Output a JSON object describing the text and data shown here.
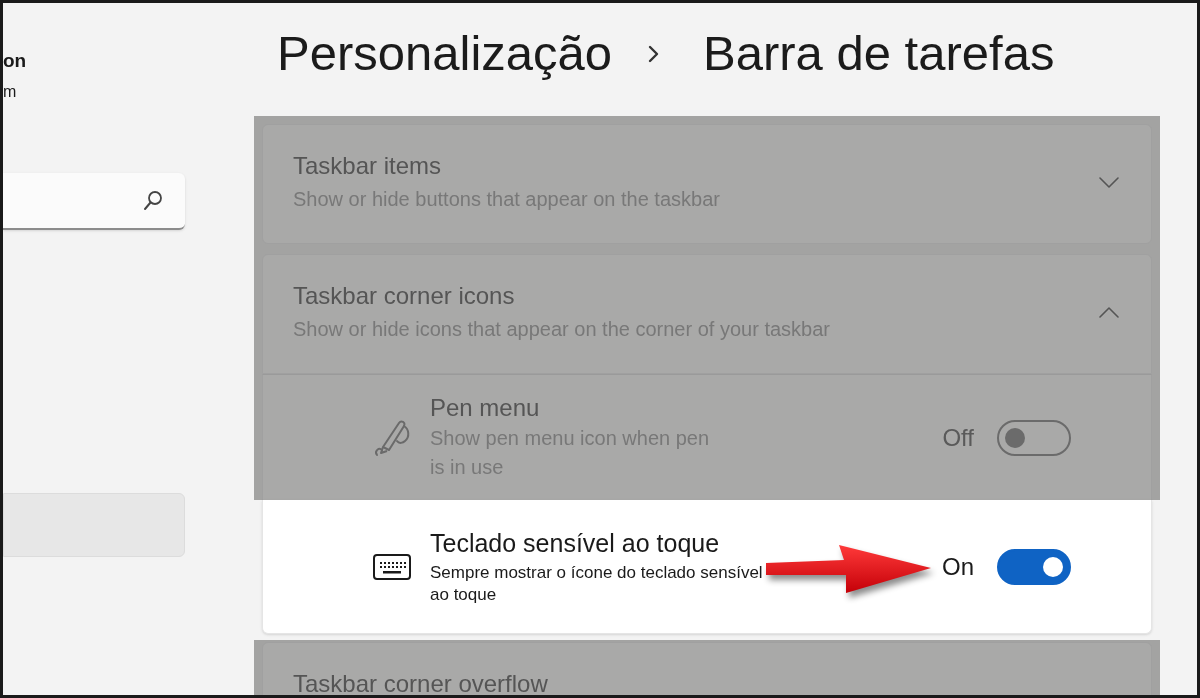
{
  "sidebar": {
    "profile_name": "on",
    "profile_subtitle": "m",
    "nav_items": [
      {
        "selected": true
      }
    ]
  },
  "breadcrumb": [
    {
      "label": "Personalização"
    },
    {
      "label": "Barra de tarefas"
    }
  ],
  "settings": [
    {
      "kind": "group",
      "title": "Taskbar items",
      "subtitle": "Show or hide buttons that appear on the taskbar",
      "expanded": false,
      "highlighted": false
    },
    {
      "kind": "group",
      "title": "Taskbar corner icons",
      "subtitle": "Show or hide icons that appear on the corner of your taskbar",
      "expanded": true,
      "highlighted": false,
      "children": [
        {
          "kind": "toggle",
          "title": "Pen menu",
          "subtitle": "Show pen menu icon when pen is in use",
          "state_label": "Off",
          "on": false,
          "highlighted": false
        },
        {
          "kind": "toggle",
          "title": "Teclado sensível ao toque",
          "subtitle": "Sempre mostrar o ícone do teclado sensível ao toque",
          "state_label": "On",
          "on": true,
          "highlighted": true
        }
      ]
    },
    {
      "kind": "group",
      "title": "Taskbar corner overflow",
      "highlighted": false
    }
  ]
}
